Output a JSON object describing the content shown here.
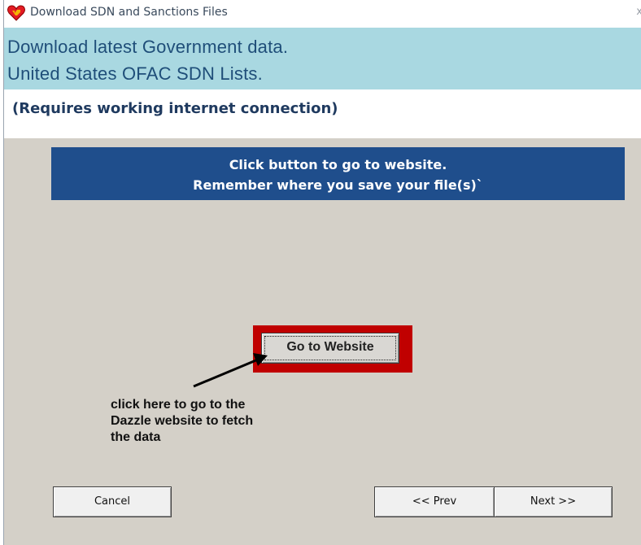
{
  "window": {
    "title": "Download SDN and Sanctions  Files",
    "close_glyph": "x",
    "app_icon": "heart-icon"
  },
  "header": {
    "line1": "Download latest Government data.",
    "line2": "United States OFAC SDN Lists."
  },
  "requirement_note": "(Requires working internet connection)",
  "banner": {
    "line1": "Click button to go to website.",
    "line2": "Remember where you save your file(s)`"
  },
  "website_button_label": "Go to Website",
  "hint": {
    "line1": "click here to go to the",
    "line2": "Dazzle website to fetch",
    "line3": "the data"
  },
  "footer": {
    "cancel_label": "Cancel",
    "prev_label": "<< Prev",
    "next_label": "Next >>"
  },
  "colors": {
    "header_bg": "#a9d8e1",
    "header_text": "#1f4e79",
    "banner_bg": "#1f4e8c",
    "highlight_frame": "#c00000",
    "panel_bg": "#d4d0c8"
  }
}
